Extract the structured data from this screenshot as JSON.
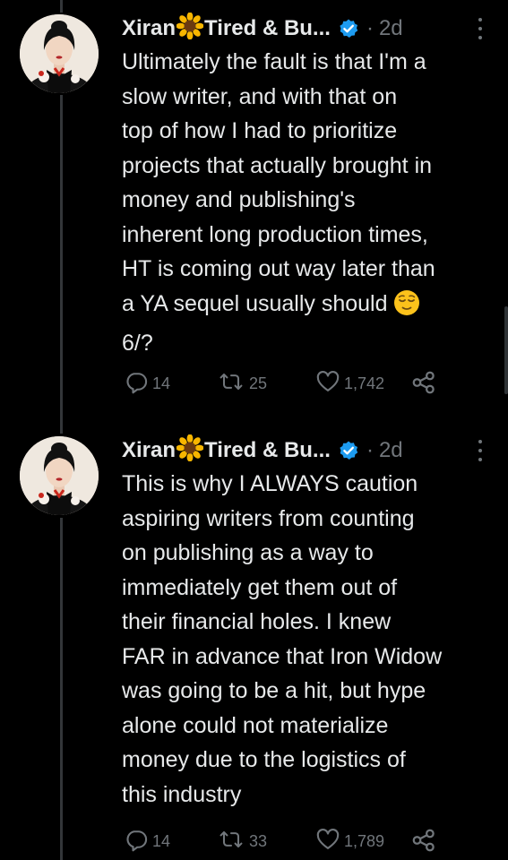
{
  "tweets": [
    {
      "author": {
        "name_part1": "Xiran",
        "name_emoji": "sunflower-icon",
        "name_part2": "Tired & Bu...",
        "verified": true
      },
      "separator": "·",
      "timestamp": "2d",
      "text_lines": [
        "Ultimately the fault is that I'm a",
        "slow writer, and with that on",
        "top of how I had to prioritize",
        "projects that actually brought in",
        "money and publishing's",
        "inherent long production times,",
        "HT is coming out way later than",
        "a YA sequel usually should",
        "6/?"
      ],
      "inline_emoji": "relieved-face-icon",
      "stats": {
        "replies": "14",
        "retweets": "25",
        "likes": "1,742"
      }
    },
    {
      "author": {
        "name_part1": "Xiran",
        "name_emoji": "sunflower-icon",
        "name_part2": "Tired & Bu...",
        "verified": true
      },
      "separator": "·",
      "timestamp": "2d",
      "text_lines": [
        "This is why I ALWAYS caution",
        "aspiring writers from counting",
        "on publishing as a way to",
        "immediately get them out of",
        "their financial holes. I knew",
        "FAR in advance that Iron Widow",
        "was going to be a hit, but hype",
        "alone could not materialize",
        "money due to the logistics of",
        "this industry"
      ],
      "stats": {
        "replies": "14",
        "retweets": "33",
        "likes": "1,789"
      }
    }
  ],
  "colors": {
    "background": "#000000",
    "text_primary": "#e7e9ea",
    "text_secondary": "#71767b",
    "verified_blue": "#1d9bf0",
    "thread_line": "#333639"
  }
}
